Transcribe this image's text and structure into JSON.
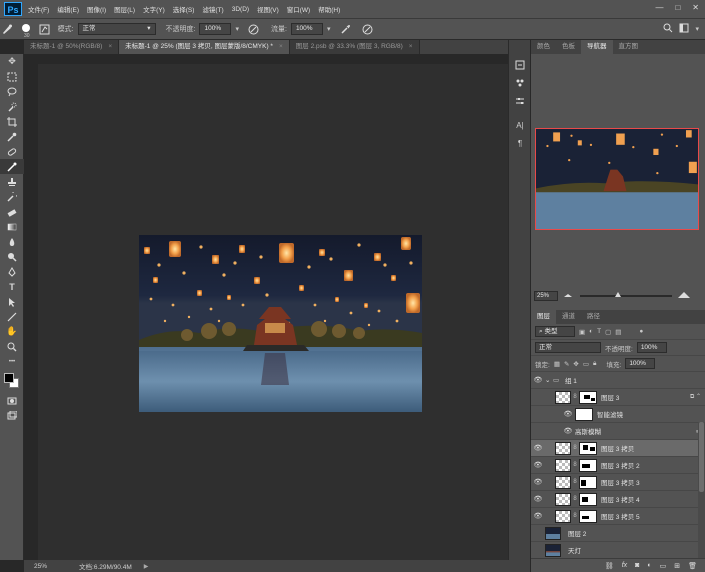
{
  "app": {
    "logo": "Ps",
    "accent": "#31a8ff"
  },
  "menu": [
    "文件(F)",
    "编辑(E)",
    "图像(I)",
    "图层(L)",
    "文字(Y)",
    "选择(S)",
    "滤镜(T)",
    "3D(D)",
    "视图(V)",
    "窗口(W)",
    "帮助(H)"
  ],
  "window_controls": {
    "min": "—",
    "max": "□",
    "close": "✕"
  },
  "options": {
    "brush_size": "30",
    "mode_label": "模式:",
    "mode_value": "正常",
    "opacity_label": "不透明度:",
    "opacity_value": "100%",
    "flow_label": "流量:",
    "flow_value": "100%"
  },
  "tabs": [
    {
      "label": "未标题-1 @ 50%(RGB/8)",
      "close": "×"
    },
    {
      "label": "未标题-1 @ 25% (图层 3 拷贝, 图层蒙版/8/CMYK) *",
      "close": "×"
    },
    {
      "label": "图层 2.psb @ 33.3% (图层 3, RGB/8)",
      "close": "×"
    }
  ],
  "status": {
    "zoom": "25%",
    "doc_info": "文档:6.29M/90.4M",
    "arrow": "▶"
  },
  "panels": {
    "top_tabs": [
      "颜色",
      "色板",
      "导航器",
      "直方图"
    ],
    "nav_zoom": "25%",
    "nav_zoom_level": 0.38,
    "layer_tabs": [
      "图层",
      "通道",
      "路径"
    ],
    "filter_kind": "类型",
    "blend_mode": "正常",
    "opacity_label": "不透明度:",
    "opacity_value": "100%",
    "lock_label": "锁定:",
    "fill_label": "填充:",
    "fill_value": "100%"
  },
  "layers": {
    "group": "组 1",
    "layer3": "图层 3",
    "smart_filter": "智能滤镜",
    "gaussian_blur": "高斯模糊",
    "copies": [
      "图层 3 拷贝",
      "图层 3 拷贝 2",
      "图层 3 拷贝 3",
      "图层 3 拷贝 4",
      "图层 3 拷贝 5"
    ],
    "layer2": "图层 2",
    "lanterns": "天灯"
  },
  "colors": {
    "fg": "#000000",
    "bg": "#ffffff",
    "ui_bg": "#535353",
    "canvas_bg": "#282828",
    "nav_frame": "#e84a4a"
  }
}
